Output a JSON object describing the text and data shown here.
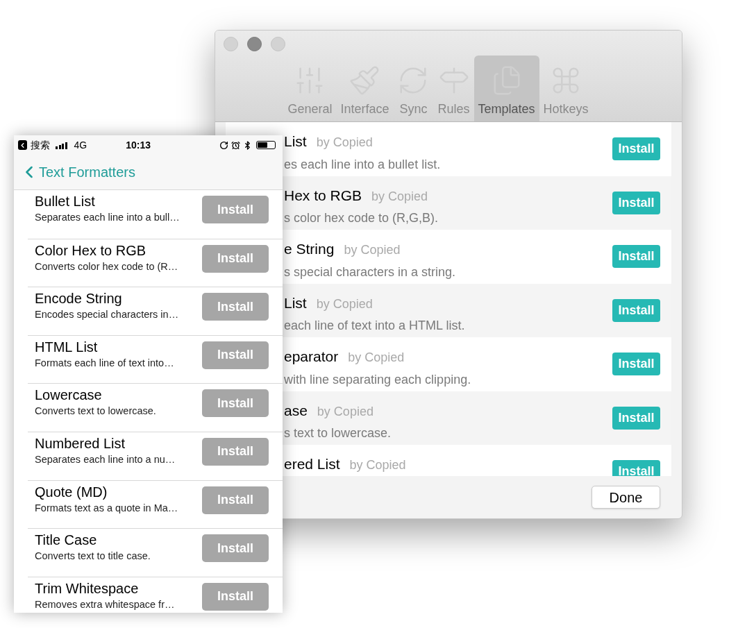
{
  "mac_window": {
    "toolbar_tabs": [
      {
        "label": "General",
        "kind": "sliders",
        "selected": false
      },
      {
        "label": "Interface",
        "kind": "brush",
        "selected": false
      },
      {
        "label": "Sync",
        "kind": "sync",
        "selected": false
      },
      {
        "label": "Rules",
        "kind": "signpost",
        "selected": false
      },
      {
        "label": "Templates",
        "kind": "files",
        "selected": true
      },
      {
        "label": "Hotkeys",
        "kind": "command",
        "selected": false
      }
    ],
    "templates": [
      {
        "name": "List",
        "author": "by Copied",
        "description": "es each line into a bullet list.",
        "button": "Install"
      },
      {
        "name": "Hex to RGB",
        "author": "by Copied",
        "description": "s color hex code to (R,G,B).",
        "button": "Install"
      },
      {
        "name": "e String",
        "author": "by Copied",
        "description": "s special characters in a string.",
        "button": "Install"
      },
      {
        "name": "List",
        "author": "by Copied",
        "description": "each line of text into a HTML list.",
        "button": "Install"
      },
      {
        "name": "eparator",
        "author": "by Copied",
        "description": "with line separating each clipping.",
        "button": "Install"
      },
      {
        "name": "ase",
        "author": "by Copied",
        "description": "s text to lowercase.",
        "button": "Install"
      },
      {
        "name": "ered List",
        "author": "by Copied",
        "button": "Install"
      }
    ],
    "done_button": "Done"
  },
  "phone": {
    "status_bar": {
      "carrier": "搜索",
      "network": "4G",
      "time": "10:13"
    },
    "nav": {
      "back_label": "Text Formatters"
    },
    "formatters": [
      {
        "name": "Bullet List",
        "description": "Separates each line into a bull…",
        "button": "Install"
      },
      {
        "name": "Color Hex to RGB",
        "description": "Converts color hex code to (R…",
        "button": "Install"
      },
      {
        "name": "Encode String",
        "description": "Encodes special characters in…",
        "button": "Install"
      },
      {
        "name": "HTML List",
        "description": "Formats each line of text into…",
        "button": "Install"
      },
      {
        "name": "Lowercase",
        "description": "Converts text to lowercase.",
        "button": "Install"
      },
      {
        "name": "Numbered List",
        "description": "Separates each line into a nu…",
        "button": "Install"
      },
      {
        "name": "Quote (MD)",
        "description": "Formats text as a quote in Ma…",
        "button": "Install"
      },
      {
        "name": "Title Case",
        "description": "Converts text to title case.",
        "button": "Install"
      },
      {
        "name": "Trim Whitespace",
        "description": "Removes extra whitespace fr…",
        "button": "Install"
      }
    ]
  }
}
